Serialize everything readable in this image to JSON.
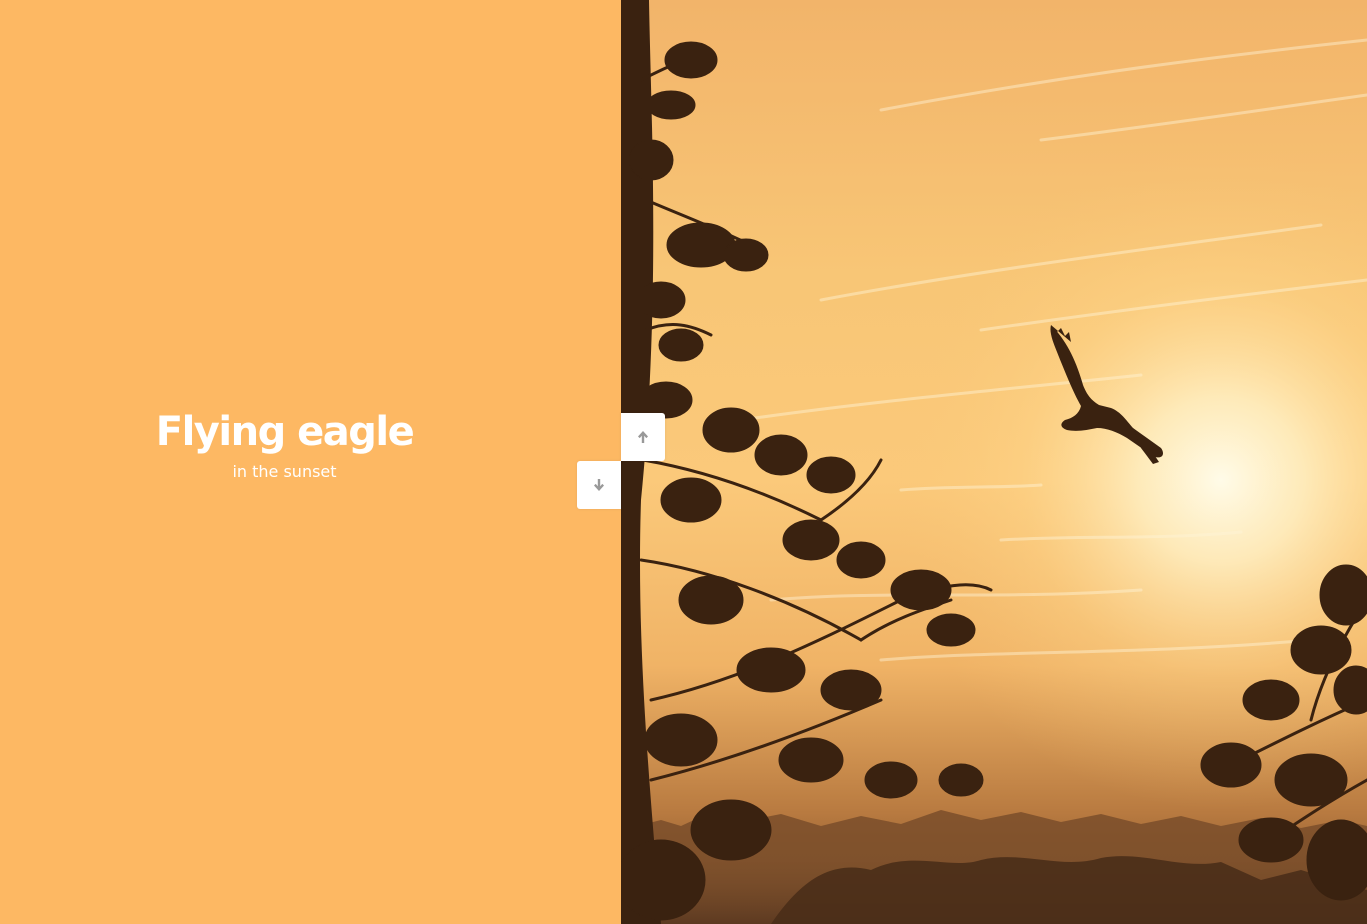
{
  "slide": {
    "title": "Flying eagle",
    "subtitle": "in the sunset"
  },
  "photo": {
    "subject": "eagle in sunset sky over pine tree silhouettes"
  },
  "navigation": {
    "up_icon": "arrow-up-icon",
    "down_icon": "arrow-down-icon"
  },
  "colors": {
    "panel_background": "#fdb863",
    "text": "#ffffff",
    "button_background": "#ffffff",
    "icon": "#999999"
  }
}
